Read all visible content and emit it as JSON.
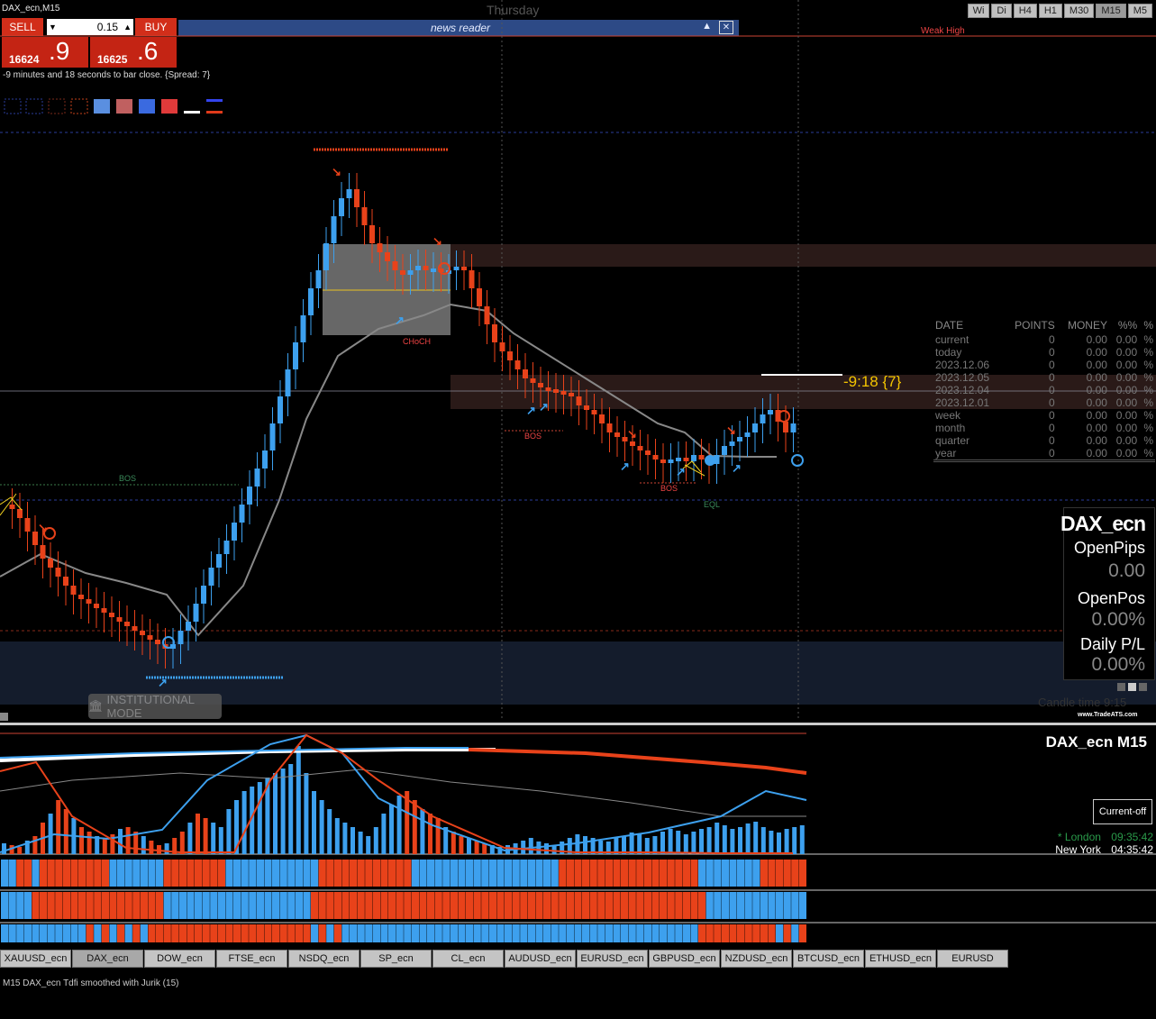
{
  "window": {
    "title": "DAX_ecn,M15",
    "day_label": "Thursday"
  },
  "timeframes": [
    {
      "label": "Wi",
      "active": false
    },
    {
      "label": "Di",
      "active": false
    },
    {
      "label": "H4",
      "active": false
    },
    {
      "label": "H1",
      "active": false
    },
    {
      "label": "M30",
      "active": false
    },
    {
      "label": "M15",
      "active": true
    },
    {
      "label": "M5",
      "active": false
    }
  ],
  "trade_panel": {
    "sell_label": "SELL",
    "buy_label": "BUY",
    "lot_value": "0.15",
    "sell_price_small": "16624",
    "sell_price_big": ".9",
    "buy_price_small": "16625",
    "buy_price_big": ".6",
    "bar_close_text": "-9 minutes and 18 seconds to bar close. {Spread: 7}"
  },
  "news_reader": {
    "title": "news reader",
    "toggle_icon": "triangle-up-icon",
    "close_icon": "close-icon"
  },
  "chart_labels": {
    "weak_high": "Weak High",
    "bos_1": "BOS",
    "bos_2": "BOS",
    "bos_3": "BOS",
    "choch": "CHoCH",
    "eql": "EQL",
    "countdown": "-9:18 {7}",
    "institutional_mode": "INSTITUTIONAL MODE",
    "candle_time": "Candle time   9:15",
    "tradeats": "www.TradeATS.com"
  },
  "stats_table": {
    "headers": [
      "DATE",
      "POINTS",
      "MONEY",
      "%%",
      "%"
    ],
    "rows": [
      {
        "date": "current",
        "points": "0",
        "money": "0.00",
        "pct": "0.00",
        "unit": "%"
      },
      {
        "date": "today",
        "points": "0",
        "money": "0.00",
        "pct": "0.00",
        "unit": "%"
      },
      {
        "date": "2023.12.06",
        "points": "0",
        "money": "0.00",
        "pct": "0.00",
        "unit": "%"
      },
      {
        "date": "2023.12.05",
        "points": "0",
        "money": "0.00",
        "pct": "0.00",
        "unit": "%"
      },
      {
        "date": "2023.12.04",
        "points": "0",
        "money": "0.00",
        "pct": "0.00",
        "unit": "%"
      },
      {
        "date": "2023.12.01",
        "points": "0",
        "money": "0.00",
        "pct": "0.00",
        "unit": "%"
      },
      {
        "date": "week",
        "points": "0",
        "money": "0.00",
        "pct": "0.00",
        "unit": "%"
      },
      {
        "date": "month",
        "points": "0",
        "money": "0.00",
        "pct": "0.00",
        "unit": "%"
      },
      {
        "date": "quarter",
        "points": "0",
        "money": "0.00",
        "pct": "0.00",
        "unit": "%"
      },
      {
        "date": "year",
        "points": "0",
        "money": "0.00",
        "pct": "0.00",
        "unit": "%"
      }
    ]
  },
  "account_panel": {
    "symbol": "DAX_ecn",
    "open_pips_label": "OpenPips",
    "open_pips_value": "0.00",
    "open_pos_label": "OpenPos",
    "open_pos_value": "0.00%",
    "daily_pl_label": "Daily P/L",
    "daily_pl_value": "0.00%"
  },
  "subwindow": {
    "title": "DAX_ecn  M15",
    "current_button": "Current-off",
    "london_label": "* London",
    "london_time": "09:35:42",
    "ny_label": "New York",
    "ny_time": "04:35:42"
  },
  "symbol_tabs": [
    {
      "label": "XAUUSD_ecn",
      "active": false
    },
    {
      "label": "DAX_ecn",
      "active": true
    },
    {
      "label": "DOW_ecn",
      "active": false
    },
    {
      "label": "FTSE_ecn",
      "active": false
    },
    {
      "label": "NSDQ_ecn",
      "active": false
    },
    {
      "label": "SP_ecn",
      "active": false
    },
    {
      "label": "CL_ecn",
      "active": false
    },
    {
      "label": "AUDUSD_ecn",
      "active": false
    },
    {
      "label": "EURUSD_ecn",
      "active": false
    },
    {
      "label": "GBPUSD_ecn",
      "active": false
    },
    {
      "label": "NZDUSD_ecn",
      "active": false
    },
    {
      "label": "BTCUSD_ecn",
      "active": false
    },
    {
      "label": "ETHUSD_ecn",
      "active": false
    },
    {
      "label": "EURUSD",
      "active": false
    }
  ],
  "footer": {
    "status": "M15 DAX_ecn Tdfi smoothed with Jurik (15)"
  },
  "colors": {
    "bull": "#3da0ee",
    "bear": "#e8421a",
    "bg": "#000000"
  },
  "chart_data": {
    "type": "candlestick",
    "note": "approximate candle closes, normalized price path; bull=blue, bear=red",
    "closes": [
      560,
      565,
      575,
      590,
      605,
      620,
      630,
      640,
      650,
      660,
      665,
      670,
      675,
      680,
      685,
      690,
      695,
      700,
      705,
      710,
      715,
      720,
      715,
      700,
      690,
      670,
      650,
      630,
      615,
      600,
      580,
      560,
      540,
      520,
      500,
      470,
      440,
      410,
      380,
      350,
      320,
      300,
      270,
      240,
      220,
      210,
      230,
      250,
      270,
      280,
      290,
      300,
      305,
      300,
      295,
      300,
      298,
      302,
      300,
      296,
      300,
      320,
      340,
      360,
      380,
      390,
      400,
      410,
      420,
      425,
      430,
      432,
      434,
      436,
      440,
      450,
      455,
      460,
      470,
      480,
      485,
      490,
      495,
      500,
      505,
      510,
      512,
      510,
      508,
      512,
      505,
      510,
      515,
      505,
      495,
      490,
      485,
      480,
      470,
      460,
      455,
      468,
      480,
      470
    ]
  },
  "oscillator_data": {
    "histogram": [
      12,
      10,
      8,
      15,
      20,
      35,
      45,
      60,
      50,
      40,
      30,
      25,
      20,
      18,
      22,
      28,
      30,
      25,
      20,
      15,
      10,
      12,
      18,
      25,
      35,
      45,
      40,
      35,
      30,
      50,
      60,
      70,
      75,
      80,
      85,
      90,
      95,
      100,
      120,
      90,
      70,
      60,
      50,
      40,
      35,
      30,
      25,
      20,
      30,
      45,
      55,
      65,
      70,
      60,
      50,
      45,
      40,
      30,
      25,
      20,
      18,
      15,
      12,
      10,
      8,
      10,
      12,
      15,
      18,
      14,
      12,
      10,
      14,
      18,
      22,
      20,
      18,
      15,
      14,
      18,
      20,
      24,
      22,
      18,
      20,
      25,
      28,
      26,
      22,
      25,
      28,
      30,
      35,
      32,
      28,
      30,
      34,
      36,
      30,
      26,
      24,
      28,
      30,
      32
    ]
  }
}
